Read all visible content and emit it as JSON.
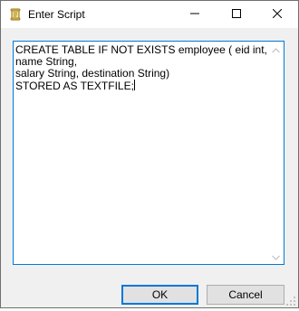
{
  "window": {
    "title": "Enter Script",
    "app_icon": "script-scroll-icon"
  },
  "caption_buttons": {
    "minimize_icon": "minimize-icon",
    "maximize_icon": "maximize-icon",
    "close_icon": "close-icon"
  },
  "editor": {
    "content": "CREATE TABLE IF NOT EXISTS employee ( eid int, name String,\nsalary String, destination String)\nSTORED AS TEXTFILE;",
    "scroll_up_icon": "scroll-up-arrow-icon",
    "scroll_down_icon": "scroll-down-arrow-icon"
  },
  "buttons": {
    "ok_label": "OK",
    "cancel_label": "Cancel"
  },
  "colors": {
    "focus_accent": "#0078d7",
    "dialog_bg": "#f0f0f0",
    "button_bg": "#e1e1e1"
  }
}
